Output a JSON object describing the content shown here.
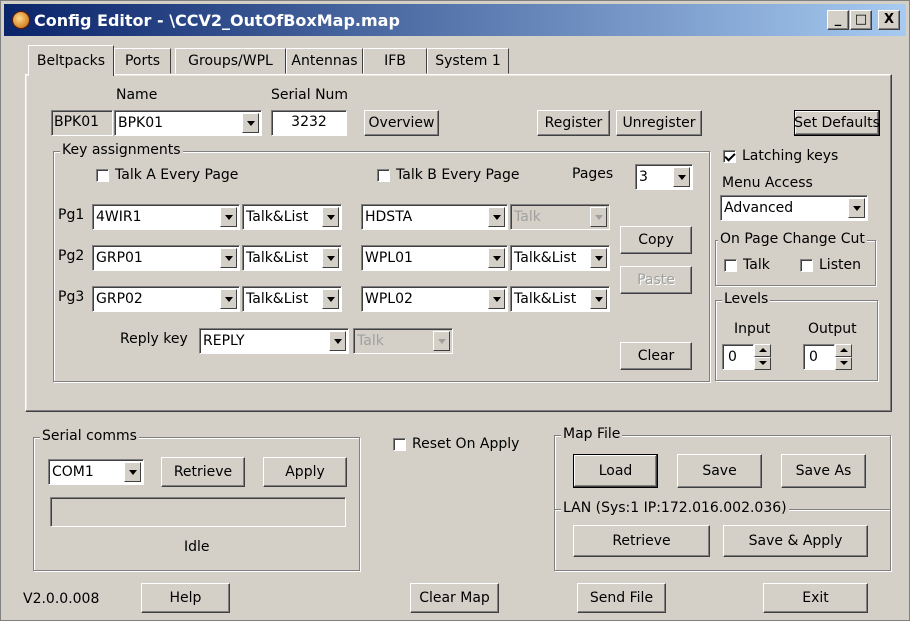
{
  "window": {
    "title": "Config Editor - \\CCV2_OutOfBoxMap.map",
    "min": "_",
    "max": "□",
    "close": "X"
  },
  "tabs": [
    "Beltpacks",
    "Ports",
    "Groups/WPL",
    "Antennas",
    "IFB",
    "System 1"
  ],
  "beltpack": {
    "id": "BPK01",
    "name_label": "Name",
    "name_value": "BPK01",
    "serial_label": "Serial Num",
    "serial_value": "3232",
    "overview": "Overview",
    "register": "Register",
    "unregister": "Unregister",
    "set_defaults": "Set Defaults"
  },
  "keys": {
    "group_label": "Key assignments",
    "talk_a": "Talk A Every Page",
    "talk_b": "Talk B Every Page",
    "pages_label": "Pages",
    "pages_value": "3",
    "rows": [
      {
        "pg": "Pg1",
        "a": "4WIR1",
        "a_mode": "Talk&List",
        "b": "HDSTA",
        "b_mode": "Talk"
      },
      {
        "pg": "Pg2",
        "a": "GRP01",
        "a_mode": "Talk&List",
        "b": "WPL01",
        "b_mode": "Talk&List"
      },
      {
        "pg": "Pg3",
        "a": "GRP02",
        "a_mode": "Talk&List",
        "b": "WPL02",
        "b_mode": "Talk&List"
      }
    ],
    "reply_label": "Reply key",
    "reply_value": "REPLY",
    "reply_mode": "Talk",
    "copy": "Copy",
    "paste": "Paste",
    "clear": "Clear"
  },
  "side": {
    "latching": "Latching keys",
    "menu_access_label": "Menu Access",
    "menu_access_value": "Advanced",
    "on_page_label": "On Page Change Cut",
    "talk": "Talk",
    "listen": "Listen",
    "levels_label": "Levels",
    "input_label": "Input",
    "output_label": "Output",
    "input_value": "0",
    "output_value": "0"
  },
  "serial": {
    "group_label": "Serial comms",
    "port": "COM1",
    "retrieve": "Retrieve",
    "apply": "Apply",
    "status": "Idle"
  },
  "reset_on_apply": "Reset On Apply",
  "mapfile": {
    "group_label": "Map File",
    "load": "Load",
    "save": "Save",
    "save_as": "Save As",
    "lan_label": "LAN  (Sys:1 IP:172.016.002.036)",
    "retrieve": "Retrieve",
    "save_apply": "Save & Apply"
  },
  "footer": {
    "version": "V2.0.0.008",
    "help": "Help",
    "clear_map": "Clear Map",
    "send_file": "Send File",
    "exit": "Exit"
  }
}
